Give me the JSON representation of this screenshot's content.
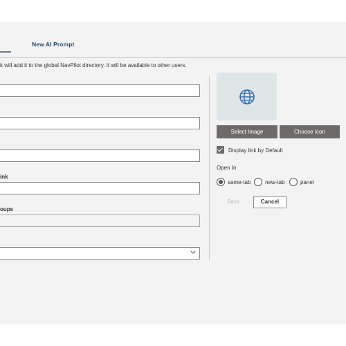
{
  "tabs": [
    {
      "label": ""
    },
    {
      "label": "New AI Prompt"
    }
  ],
  "intro_text": "k will add it to the global NavPilot directory. It will be available to other users.",
  "form": {
    "label_link": "ink",
    "label_groups": "oups",
    "field_values": [
      "",
      "",
      "",
      "",
      "",
      ""
    ]
  },
  "preview": {
    "icon": "globe-icon",
    "icon_color": "#2f6db5"
  },
  "buttons": {
    "select_image": "Select Image",
    "choose_icon": "Choose Icon",
    "save": "Save",
    "cancel": "Cancel"
  },
  "display_default": {
    "label": "Display link by Default",
    "checked": true
  },
  "open_in": {
    "label": "Open In",
    "options": [
      {
        "label": "same-tab",
        "selected": true
      },
      {
        "label": "new-tab",
        "selected": false
      },
      {
        "label": "panel",
        "selected": false
      }
    ]
  },
  "colors": {
    "accent_dark": "#6e6a69",
    "tab_text": "#2b4a6b",
    "panel_bg": "#f3f3f3"
  }
}
